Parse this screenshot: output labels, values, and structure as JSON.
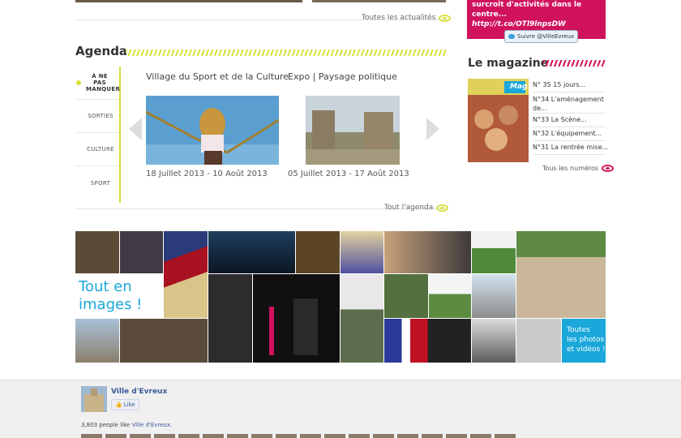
{
  "news": {
    "all_label": "Toutes les actualités"
  },
  "twitter": {
    "text_line1": "surcroît d'activités dans le",
    "text_line2": "centre...",
    "link": "http://t.co/OTl9lnpsDW",
    "follow_label": "Suivre @VilleEvreux"
  },
  "agenda": {
    "title": "Agenda",
    "menu": [
      {
        "label": "À NE PAS MANQUER",
        "active": true
      },
      {
        "label": "SORTIES"
      },
      {
        "label": "CULTURE"
      },
      {
        "label": "SPORT"
      }
    ],
    "events": [
      {
        "title": "Village du Sport et de la Culture",
        "date": "18 Juillet 2013 - 10 Août 2013"
      },
      {
        "title": "Expo | Paysage politique",
        "date": "05 Juillet 2013 - 17 Août 2013"
      }
    ],
    "all_label": "Tout l'agenda"
  },
  "magazine": {
    "title": "Le magazine",
    "cover_label": "Mag",
    "items": [
      "N° 35 15 jours...",
      "N°34 L'aménagement de...",
      "N°33 La Scène...",
      "N°32 L'équipement...",
      "N°31 La rentrée mise..."
    ],
    "all_label": "Tous les numéros"
  },
  "gallery": {
    "title_line1": "Tout en",
    "title_line2": "images !",
    "cta_line1": "Toutes",
    "cta_line2": "les photos",
    "cta_line3": "et vidéos !"
  },
  "facebook": {
    "page_name": "Ville d'Evreux",
    "like_label": "Like",
    "count_text": "3,803 people like ",
    "count_link": "Ville d'Evreux",
    "count_end": "."
  },
  "colors": {
    "accent_yellow": "#d8e03a",
    "accent_pink": "#d0125d",
    "accent_blue": "#1aa7d9"
  }
}
